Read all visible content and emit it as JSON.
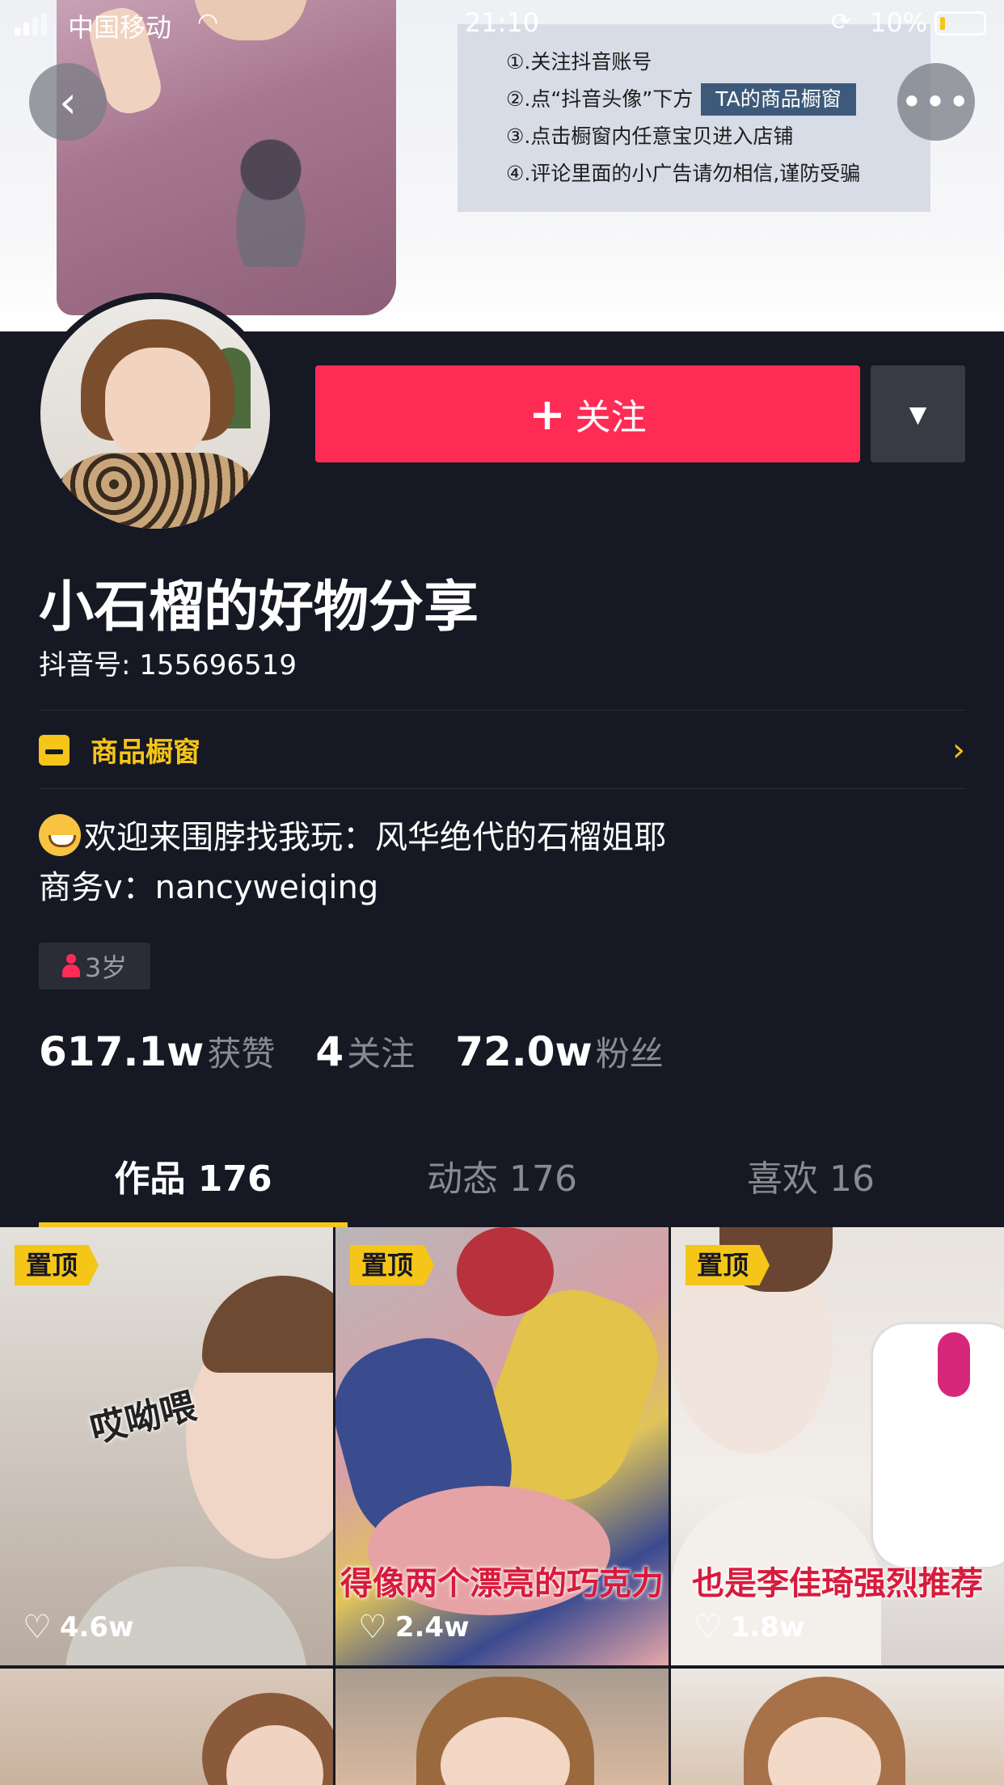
{
  "status_bar": {
    "carrier": "中国移动",
    "time": "21:10",
    "battery": "10%"
  },
  "banner": {
    "notes": [
      "①.关注抖音账号",
      "②.点“抖音头像”下方",
      "③.点击橱窗内任意宝贝进入店铺",
      "④.评论里面的小广告请勿相信,谨防受骗"
    ],
    "chip": "TA的商品橱窗"
  },
  "profile": {
    "follow_label": "关注",
    "nickname": "小石榴的好物分享",
    "douyin_id": "抖音号: 155696519",
    "shop_label": "商品橱窗",
    "bio_line1": "欢迎来围脖找我玩：风华绝代的石榴姐耶",
    "bio_line2": "商务v：nancyweiqing",
    "age": "3岁"
  },
  "stats": [
    {
      "value": "617.1w",
      "label": "获赞"
    },
    {
      "value": "4",
      "label": "关注"
    },
    {
      "value": "72.0w",
      "label": "粉丝"
    }
  ],
  "tabs": [
    {
      "label": "作品 176"
    },
    {
      "label": "动态 176"
    },
    {
      "label": "喜欢 16"
    }
  ],
  "videos": [
    {
      "pin": "置顶",
      "likes": "4.6w",
      "overlay": "哎呦喂",
      "caption": ""
    },
    {
      "pin": "置顶",
      "likes": "2.4w",
      "overlay": "",
      "caption": "得像两个漂亮的巧克力"
    },
    {
      "pin": "置顶",
      "likes": "1.8w",
      "overlay": "",
      "caption": "也是李佳琦强烈推荐"
    }
  ],
  "colors": {
    "accent": "#fe2c55",
    "highlight": "#f5c518",
    "background": "#161823"
  }
}
